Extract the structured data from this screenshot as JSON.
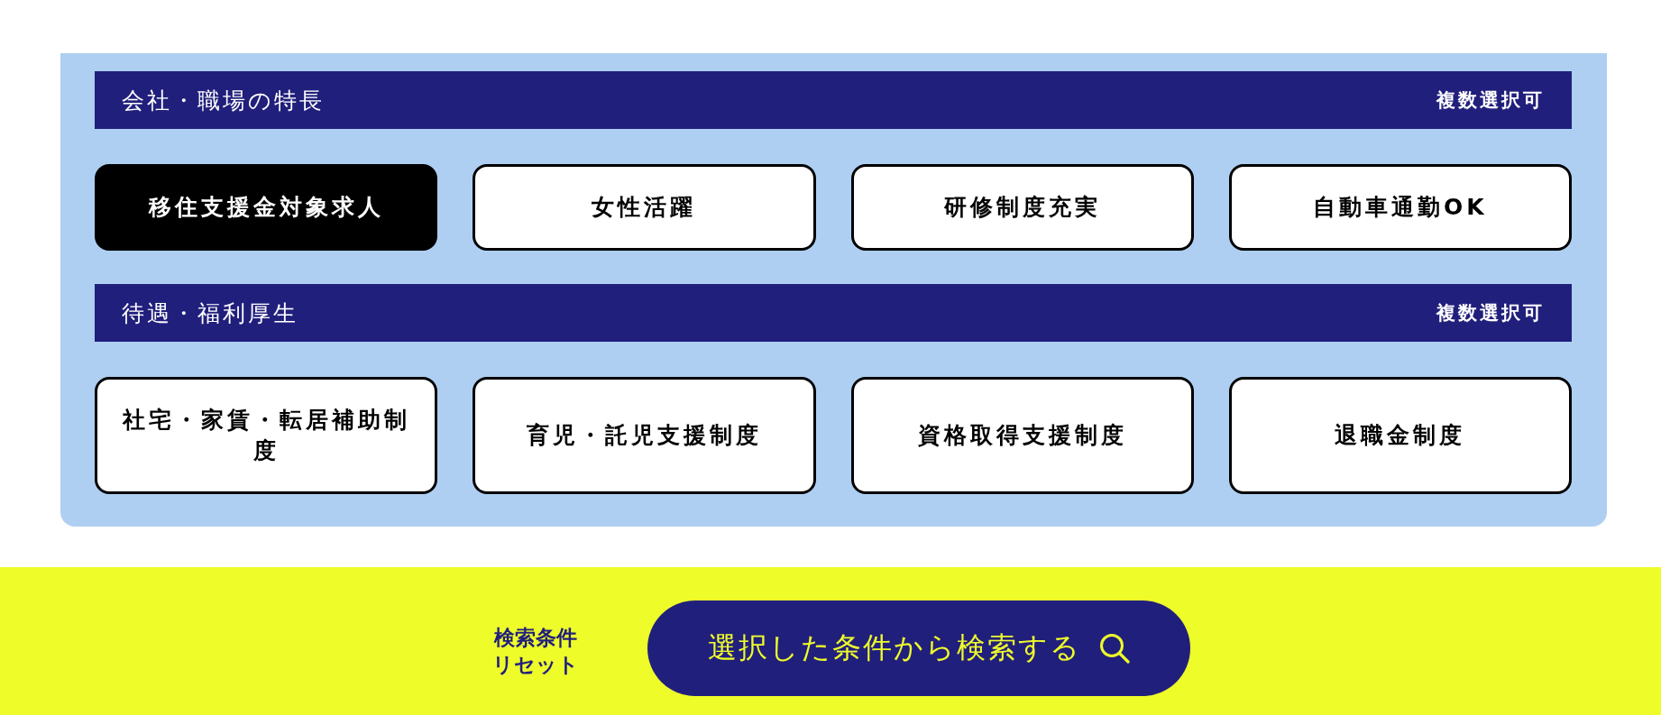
{
  "sections": [
    {
      "title": "会社・職場の特長",
      "note": "複数選択可",
      "options": [
        {
          "label": "移住支援金対象求人",
          "selected": true
        },
        {
          "label": "女性活躍",
          "selected": false
        },
        {
          "label": "研修制度充実",
          "selected": false
        },
        {
          "label": "自動車通勤OK",
          "selected": false
        }
      ]
    },
    {
      "title": "待遇・福利厚生",
      "note": "複数選択可",
      "options": [
        {
          "label": "社宅・家賃・転居補助制度",
          "selected": false
        },
        {
          "label": "育児・託児支援制度",
          "selected": false
        },
        {
          "label": "資格取得支援制度",
          "selected": false
        },
        {
          "label": "退職金制度",
          "selected": false
        }
      ]
    }
  ],
  "footer": {
    "reset_label": "検索条件リセット",
    "search_label": "選択した条件から検索する"
  }
}
